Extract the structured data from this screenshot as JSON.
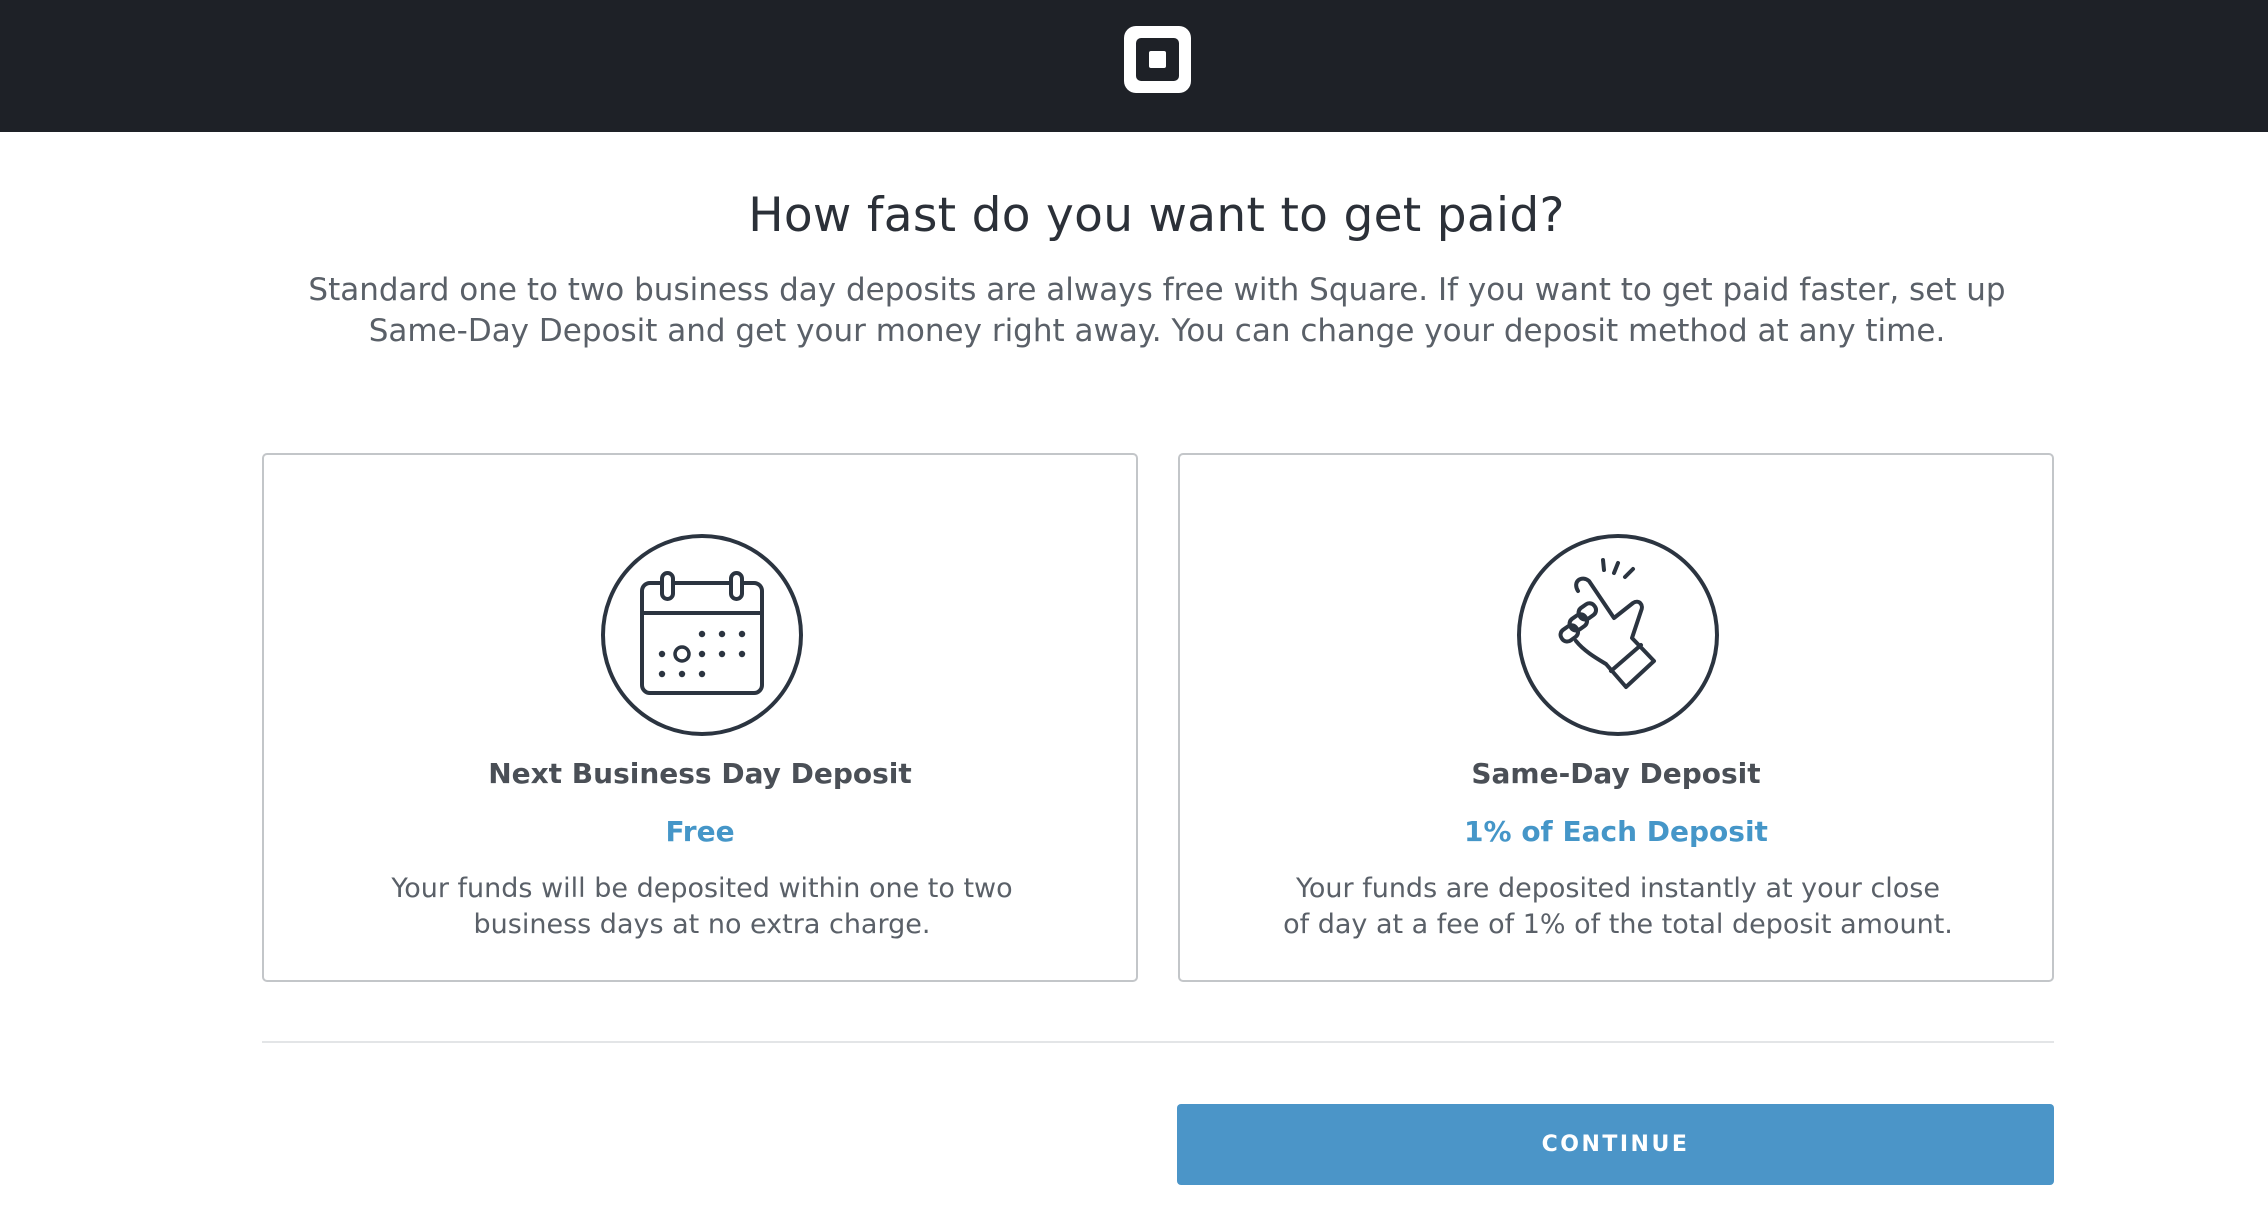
{
  "header": {
    "logo_icon": "square-logo-icon",
    "background_color": "#1e2127"
  },
  "main": {
    "heading": "How fast do you want to get paid?",
    "subtitle": "Standard one to two business day deposits are always free with Square. If you want to get paid faster, set up Same-Day Deposit and get your money right away. You can change your deposit method at any time."
  },
  "options": [
    {
      "icon": "calendar-icon",
      "title": "Next Business Day Deposit",
      "price": "Free",
      "description": "Your funds will be deposited within one to two business days at no extra charge."
    },
    {
      "icon": "snap-fingers-icon",
      "title": "Same-Day Deposit",
      "price": "1% of Each Deposit",
      "description": "Your funds are deposited instantly at your close of day at a fee of 1% of the total deposit amount."
    }
  ],
  "footer": {
    "continue_label": "CONTINUE"
  },
  "colors": {
    "accent": "#4596c8",
    "button": "#4b95c8",
    "text": "#3e4348"
  }
}
